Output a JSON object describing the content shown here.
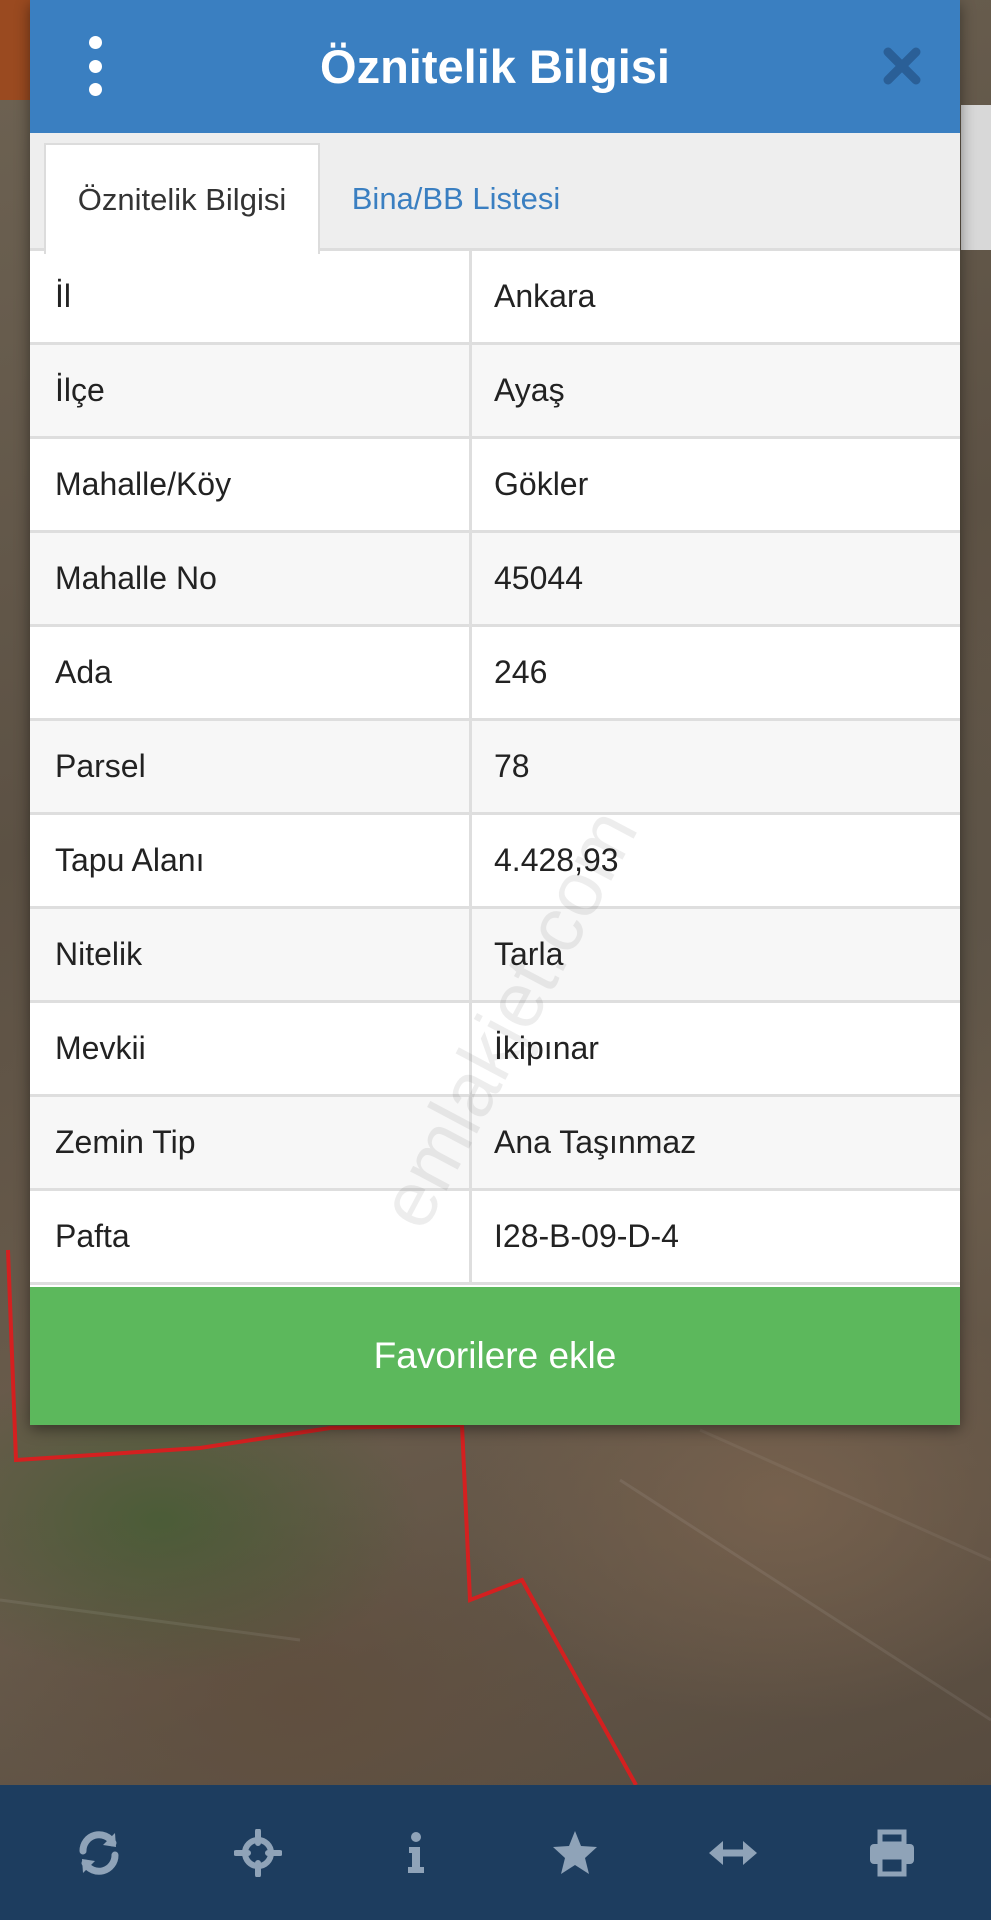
{
  "dialog": {
    "title": "Öznitelik Bilgisi",
    "menu_icon": "kebab-menu-icon",
    "close_icon": "close-icon"
  },
  "tabs": [
    {
      "label": "Öznitelik Bilgisi",
      "active": true
    },
    {
      "label": "Bina/BB Listesi",
      "active": false
    }
  ],
  "attributes": [
    {
      "label": "İl",
      "value": "Ankara"
    },
    {
      "label": "İlçe",
      "value": "Ayaş"
    },
    {
      "label": "Mahalle/Köy",
      "value": "Gökler"
    },
    {
      "label": "Mahalle No",
      "value": "45044"
    },
    {
      "label": "Ada",
      "value": "246"
    },
    {
      "label": "Parsel",
      "value": "78"
    },
    {
      "label": "Tapu Alanı",
      "value": "4.428,93"
    },
    {
      "label": "Nitelik",
      "value": "Tarla"
    },
    {
      "label": "Mevkii",
      "value": "İkipınar"
    },
    {
      "label": "Zemin Tip",
      "value": "Ana Taşınmaz"
    },
    {
      "label": "Pafta",
      "value": "I28-B-09-D-4"
    }
  ],
  "favorite_button": {
    "label": "Favorilere ekle"
  },
  "watermark": "emlakjet.com",
  "toolbar": [
    {
      "icon": "refresh-icon"
    },
    {
      "icon": "crosshair-icon"
    },
    {
      "icon": "info-icon"
    },
    {
      "icon": "star-icon"
    },
    {
      "icon": "measure-icon"
    },
    {
      "icon": "print-icon"
    }
  ],
  "colors": {
    "header": "#3a7fc1",
    "tab_link": "#3a7fc1",
    "favorite_button": "#5cb85c",
    "toolbar": "#1d3d5f",
    "toolbar_icon": "#8fa3b8",
    "parcel_border": "#d42020"
  }
}
